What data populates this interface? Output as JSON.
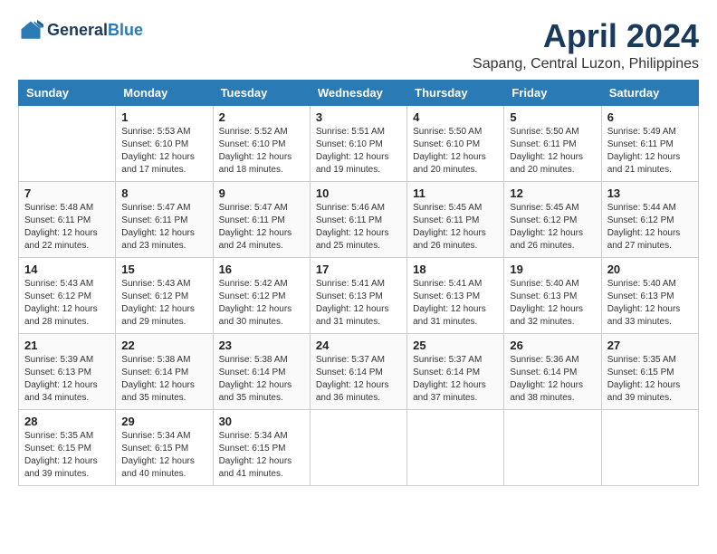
{
  "header": {
    "logo_line1": "General",
    "logo_line2": "Blue",
    "title": "April 2024",
    "subtitle": "Sapang, Central Luzon, Philippines"
  },
  "columns": [
    "Sunday",
    "Monday",
    "Tuesday",
    "Wednesday",
    "Thursday",
    "Friday",
    "Saturday"
  ],
  "weeks": [
    [
      {
        "day": "",
        "info": ""
      },
      {
        "day": "1",
        "info": "Sunrise: 5:53 AM\nSunset: 6:10 PM\nDaylight: 12 hours\nand 17 minutes."
      },
      {
        "day": "2",
        "info": "Sunrise: 5:52 AM\nSunset: 6:10 PM\nDaylight: 12 hours\nand 18 minutes."
      },
      {
        "day": "3",
        "info": "Sunrise: 5:51 AM\nSunset: 6:10 PM\nDaylight: 12 hours\nand 19 minutes."
      },
      {
        "day": "4",
        "info": "Sunrise: 5:50 AM\nSunset: 6:10 PM\nDaylight: 12 hours\nand 20 minutes."
      },
      {
        "day": "5",
        "info": "Sunrise: 5:50 AM\nSunset: 6:11 PM\nDaylight: 12 hours\nand 20 minutes."
      },
      {
        "day": "6",
        "info": "Sunrise: 5:49 AM\nSunset: 6:11 PM\nDaylight: 12 hours\nand 21 minutes."
      }
    ],
    [
      {
        "day": "7",
        "info": "Sunrise: 5:48 AM\nSunset: 6:11 PM\nDaylight: 12 hours\nand 22 minutes."
      },
      {
        "day": "8",
        "info": "Sunrise: 5:47 AM\nSunset: 6:11 PM\nDaylight: 12 hours\nand 23 minutes."
      },
      {
        "day": "9",
        "info": "Sunrise: 5:47 AM\nSunset: 6:11 PM\nDaylight: 12 hours\nand 24 minutes."
      },
      {
        "day": "10",
        "info": "Sunrise: 5:46 AM\nSunset: 6:11 PM\nDaylight: 12 hours\nand 25 minutes."
      },
      {
        "day": "11",
        "info": "Sunrise: 5:45 AM\nSunset: 6:11 PM\nDaylight: 12 hours\nand 26 minutes."
      },
      {
        "day": "12",
        "info": "Sunrise: 5:45 AM\nSunset: 6:12 PM\nDaylight: 12 hours\nand 26 minutes."
      },
      {
        "day": "13",
        "info": "Sunrise: 5:44 AM\nSunset: 6:12 PM\nDaylight: 12 hours\nand 27 minutes."
      }
    ],
    [
      {
        "day": "14",
        "info": "Sunrise: 5:43 AM\nSunset: 6:12 PM\nDaylight: 12 hours\nand 28 minutes."
      },
      {
        "day": "15",
        "info": "Sunrise: 5:43 AM\nSunset: 6:12 PM\nDaylight: 12 hours\nand 29 minutes."
      },
      {
        "day": "16",
        "info": "Sunrise: 5:42 AM\nSunset: 6:12 PM\nDaylight: 12 hours\nand 30 minutes."
      },
      {
        "day": "17",
        "info": "Sunrise: 5:41 AM\nSunset: 6:13 PM\nDaylight: 12 hours\nand 31 minutes."
      },
      {
        "day": "18",
        "info": "Sunrise: 5:41 AM\nSunset: 6:13 PM\nDaylight: 12 hours\nand 31 minutes."
      },
      {
        "day": "19",
        "info": "Sunrise: 5:40 AM\nSunset: 6:13 PM\nDaylight: 12 hours\nand 32 minutes."
      },
      {
        "day": "20",
        "info": "Sunrise: 5:40 AM\nSunset: 6:13 PM\nDaylight: 12 hours\nand 33 minutes."
      }
    ],
    [
      {
        "day": "21",
        "info": "Sunrise: 5:39 AM\nSunset: 6:13 PM\nDaylight: 12 hours\nand 34 minutes."
      },
      {
        "day": "22",
        "info": "Sunrise: 5:38 AM\nSunset: 6:14 PM\nDaylight: 12 hours\nand 35 minutes."
      },
      {
        "day": "23",
        "info": "Sunrise: 5:38 AM\nSunset: 6:14 PM\nDaylight: 12 hours\nand 35 minutes."
      },
      {
        "day": "24",
        "info": "Sunrise: 5:37 AM\nSunset: 6:14 PM\nDaylight: 12 hours\nand 36 minutes."
      },
      {
        "day": "25",
        "info": "Sunrise: 5:37 AM\nSunset: 6:14 PM\nDaylight: 12 hours\nand 37 minutes."
      },
      {
        "day": "26",
        "info": "Sunrise: 5:36 AM\nSunset: 6:14 PM\nDaylight: 12 hours\nand 38 minutes."
      },
      {
        "day": "27",
        "info": "Sunrise: 5:35 AM\nSunset: 6:15 PM\nDaylight: 12 hours\nand 39 minutes."
      }
    ],
    [
      {
        "day": "28",
        "info": "Sunrise: 5:35 AM\nSunset: 6:15 PM\nDaylight: 12 hours\nand 39 minutes."
      },
      {
        "day": "29",
        "info": "Sunrise: 5:34 AM\nSunset: 6:15 PM\nDaylight: 12 hours\nand 40 minutes."
      },
      {
        "day": "30",
        "info": "Sunrise: 5:34 AM\nSunset: 6:15 PM\nDaylight: 12 hours\nand 41 minutes."
      },
      {
        "day": "",
        "info": ""
      },
      {
        "day": "",
        "info": ""
      },
      {
        "day": "",
        "info": ""
      },
      {
        "day": "",
        "info": ""
      }
    ]
  ]
}
